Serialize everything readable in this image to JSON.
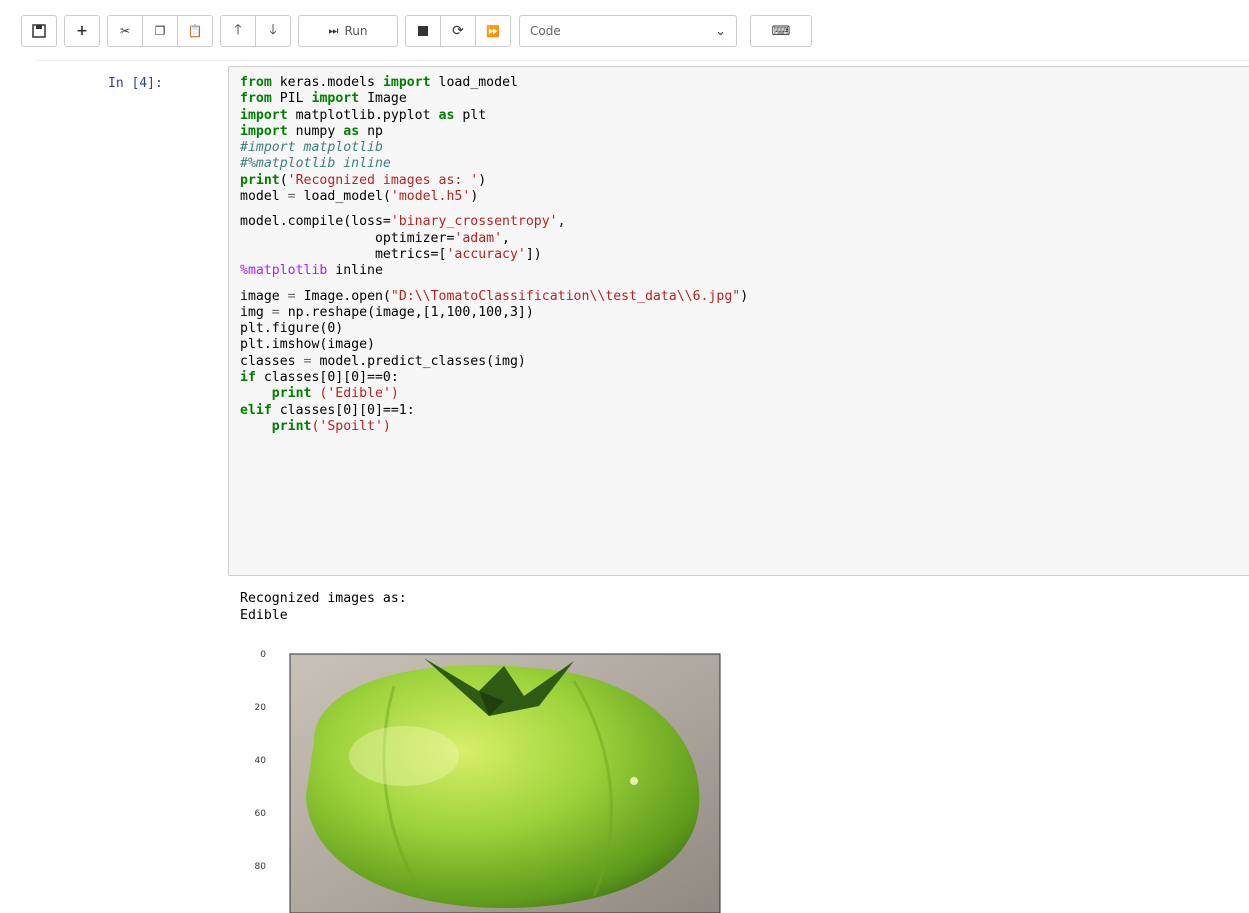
{
  "toolbar": {
    "run_label": "Run",
    "cell_type": "Code"
  },
  "cell": {
    "prompt": "In [4]:",
    "code": {
      "l1": [
        "from",
        "keras.models",
        "import",
        "load_model"
      ],
      "l2": [
        "from",
        "PIL",
        "import",
        "Image"
      ],
      "l3": [
        "import",
        "matplotlib.pyplot",
        "as",
        "plt"
      ],
      "l4": [
        "import",
        "numpy",
        "as",
        "np"
      ],
      "l5": "#import matplotlib",
      "l6": "#%matplotlib inline",
      "l7": [
        "print",
        "'Recognized images as: '"
      ],
      "l8": [
        "model",
        "=",
        "load_model(",
        "'model.h5'",
        ")"
      ],
      "l9": [
        "model.compile(loss=",
        "'binary_crossentropy'",
        ","
      ],
      "l10": [
        "optimizer=",
        "'adam'",
        ","
      ],
      "l11": [
        "metrics=[",
        "'accuracy'",
        "])"
      ],
      "l12": [
        "%matplotlib",
        "inline"
      ],
      "l13": [
        "image",
        "=",
        "Image.open(",
        "\"D:\\\\TomatoClassification\\\\test_data\\\\6.jpg\"",
        ")"
      ],
      "l14": [
        "img",
        "=",
        "np.reshape(image,[1,100,100,3])"
      ],
      "l15": "plt.figure(0)",
      "l16": "plt.imshow(image)",
      "l17": [
        "classes",
        "=",
        "model.predict_classes(img)"
      ],
      "l18": [
        "if",
        "classes[0][0]==0:"
      ],
      "l19": [
        "print",
        "('Edible')"
      ],
      "l20": [
        "elif",
        "classes[0][0]==1:"
      ],
      "l21": [
        "print",
        "('Spoilt')"
      ]
    },
    "output": {
      "line1": "Recognized images as:",
      "line2": "Edible"
    },
    "plot": {
      "yticks": [
        "0",
        "20",
        "40",
        "60",
        "80"
      ]
    }
  },
  "colors": {
    "keyword": "#008000",
    "string": "#ba2121",
    "comment": "#408080",
    "magic": "#aa22ff",
    "prompt": "#303f9f"
  }
}
